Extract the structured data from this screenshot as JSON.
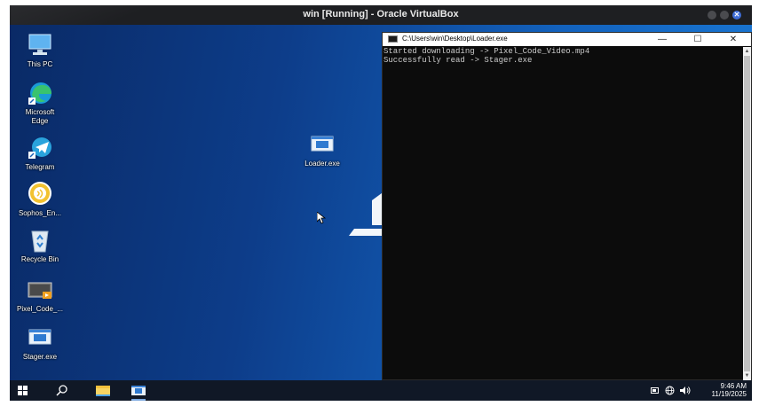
{
  "vbox": {
    "title": "win [Running] - Oracle VirtualBox",
    "close_glyph": "✕"
  },
  "desktop_icons": [
    {
      "label": "This PC",
      "icon": "computer-icon"
    },
    {
      "label": "Microsoft Edge",
      "icon": "edge-icon"
    },
    {
      "label": "Telegram",
      "icon": "telegram-icon"
    },
    {
      "label": "Sophos_En...",
      "icon": "sophos-icon"
    },
    {
      "label": "Recycle Bin",
      "icon": "recycle-bin-icon"
    },
    {
      "label": "Pixel_Code_...",
      "icon": "video-file-icon"
    },
    {
      "label": "Stager.exe",
      "icon": "exe-file-icon"
    },
    {
      "label": "Loader.exe",
      "icon": "exe-file-icon"
    }
  ],
  "console": {
    "title": "C:\\Users\\win\\Desktop\\Loader.exe",
    "min_glyph": "—",
    "max_glyph": "☐",
    "close_glyph": "✕",
    "lines": [
      "Started downloading -> Pixel_Code_Video.mp4",
      "Successfully read -> Stager.exe"
    ],
    "scroll_up_glyph": "▲",
    "scroll_down_glyph": "▼"
  },
  "taskbar": {
    "items": [
      "start-icon",
      "search-icon",
      "file-explorer-icon",
      "console-app-icon"
    ],
    "time": "9:46 AM",
    "date": "11/19/2025",
    "tray_icons": [
      "battery-icon",
      "network-icon",
      "volume-icon"
    ]
  },
  "colors": {
    "desktop_blue": "#1363bf",
    "taskbar": "#101826",
    "console_bg": "#0c0c0c",
    "console_text": "#cccccc"
  }
}
